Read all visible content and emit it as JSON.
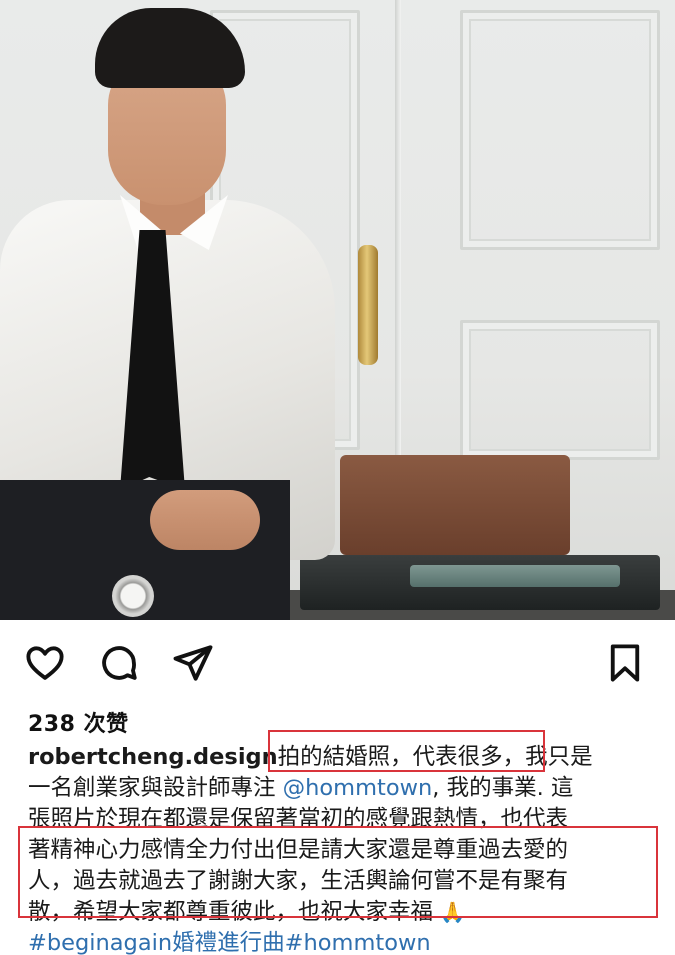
{
  "post": {
    "image": {
      "description_icon": "photo"
    },
    "actions": {
      "like_icon": "heart-icon",
      "comment_icon": "comment-icon",
      "share_icon": "paper-plane-icon",
      "save_icon": "bookmark-icon"
    },
    "likes_text": "238 次赞",
    "caption": {
      "username": "robertcheng.design",
      "line1_rest": "拍的結婚照，代表很多，我只是",
      "line2_prefix": "一名創業家與設計師專注 ",
      "mention": "@hommtown",
      "line2_suffix": ", 我的事業. 這",
      "line3": "張照片於現在都還是保留著當初的感覺跟熱情，也代表",
      "line4": "著精神心力感情全力付出但是請大家還是尊重過去愛的",
      "line5": "人，過去就過去了謝謝大家，生活輿論何嘗不是有聚有",
      "line6": "散，希望大家都尊重彼此，也祝大家幸福 ",
      "emoji": "🙏",
      "hashtag1": "#beginagain",
      "hashtag_mid": "婚禮進行曲",
      "hashtag2": "#hommtown"
    },
    "highlight_color": "#d9343b",
    "link_color": "#2f6fae"
  }
}
